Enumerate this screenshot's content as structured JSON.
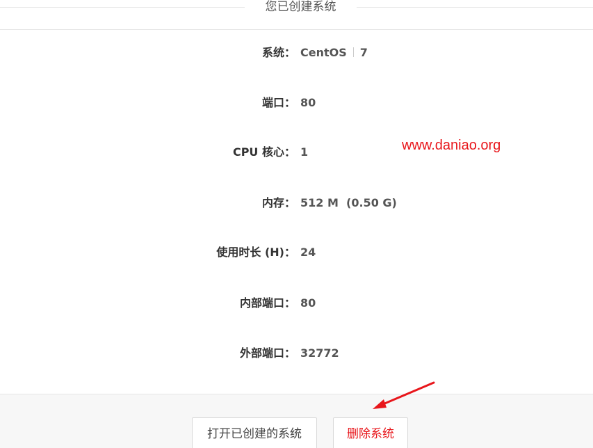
{
  "header": {
    "title": "您已创建系统"
  },
  "info": {
    "system": {
      "label": "系统：",
      "name": "CentOS",
      "version": "7"
    },
    "port": {
      "label": "端口：",
      "value": "80"
    },
    "cpu": {
      "label": "CPU 核心：",
      "value": "1"
    },
    "memory": {
      "label": "内存：",
      "value": "512 M  (0.50 G)"
    },
    "duration": {
      "label": "使用时长 (H)：",
      "value": "24"
    },
    "internal_port": {
      "label": "内部端口：",
      "value": "80"
    },
    "external_port": {
      "label": "外部端口：",
      "value": "32772"
    }
  },
  "watermark": "www.daniao.org",
  "footer": {
    "open_label": "打开已创建的系统",
    "delete_label": "删除系统"
  },
  "colors": {
    "accent_red": "#e8161b",
    "footer_bg": "#f7f7f7",
    "divider": "#e6e6e6"
  },
  "icons": {
    "annotation": "red-arrow-icon"
  }
}
